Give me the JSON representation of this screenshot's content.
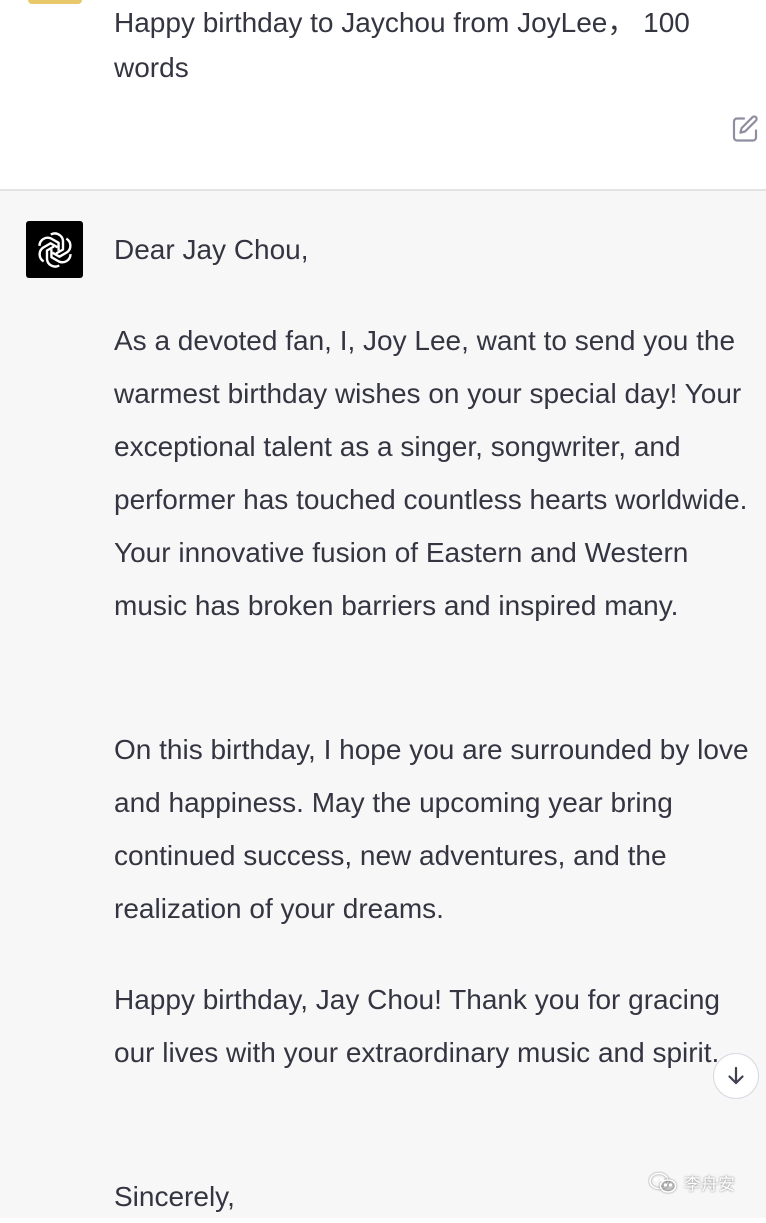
{
  "conversation": {
    "user_message": {
      "text": "Happy birthday to Jaychou from JoyLee， 100 words",
      "edit_icon": "edit-icon"
    },
    "assistant_message": {
      "avatar_icon": "openai-logo-icon",
      "paragraphs": [
        "Dear Jay Chou,",
        "As a devoted fan, I, Joy Lee, want to send you the warmest birthday wishes on your special day! Your exceptional talent as a singer, songwriter, and performer has touched countless hearts worldwide. Your innovative fusion of Eastern and Western music has broken barriers and inspired many.",
        "On this birthday, I hope you are surrounded by love and happiness. May the upcoming year bring continued success, new adventures, and the realization of your dreams.",
        "Happy birthday, Jay Chou! Thank you for gracing our lives with your extraordinary music and spirit.",
        "Sincerely,"
      ]
    },
    "scroll_down_icon": "arrow-down-icon"
  },
  "watermark": {
    "icon": "wechat-icon",
    "text": "李舟安"
  },
  "colors": {
    "text": "#343541",
    "assistant_bg": "#f7f7f8",
    "avatar_bg": "#000000",
    "user_avatar": "#e8c86a"
  }
}
